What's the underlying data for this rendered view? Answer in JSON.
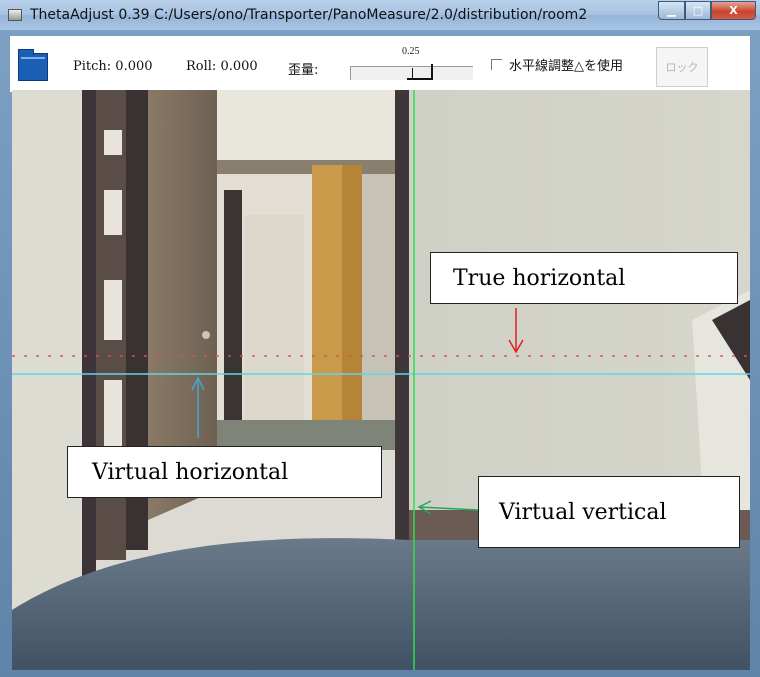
{
  "window": {
    "title": "ThetaAdjust 0.39  C:/Users/ono/Transporter/PanoMeasure/2.0/distribution/room2",
    "buttons": {
      "minimize": "▁",
      "maximize": "□",
      "close": "X"
    }
  },
  "toolbar": {
    "pitch_label": "Pitch: 0.000",
    "roll_label": "Roll: 0.000",
    "distortion_label": "歪量:",
    "slider_value": "0.25",
    "horizon_checkbox_label": "水平線調整△を使用",
    "horizon_checkbox_checked": false,
    "lock_button_label": "ロック"
  },
  "annotations": {
    "true_horizontal": "True horizontal",
    "virtual_horizontal": "Virtual horizontal",
    "virtual_vertical": "Virtual vertical"
  },
  "colors": {
    "virtual_horizontal_line": "#5fd6e8",
    "virtual_vertical_line": "#2ee04a",
    "true_horizontal_line": "#e05050",
    "arrow_true": "#e0201c",
    "arrow_virtual_horizontal": "#4aa3d0",
    "arrow_virtual_vertical": "#1faa55",
    "folder_icon": "#1a5fb4"
  }
}
